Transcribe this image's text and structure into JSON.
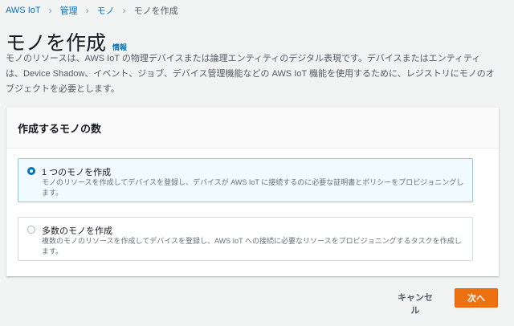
{
  "breadcrumb": [
    "AWS IoT",
    "管理",
    "モノ",
    "モノを作成"
  ],
  "header": {
    "title": "モノを作成",
    "info_link": "情報"
  },
  "description": "モノのリソースは、AWS IoT の物理デバイスまたは論理エンティティのデジタル表現です。デバイスまたはエンティティは、Device Shadow、イベント、ジョブ、デバイス管理機能などの AWS IoT 機能を使用するために、レジストリにモノのオブジェクトを必要とします。",
  "card": {
    "title": "作成するモノの数",
    "options": [
      {
        "label": "1 つのモノを作成",
        "description": "モノのリソースを作成してデバイスを登録し、デバイスが AWS IoT に接続するのに必要な証明書とポリシーをプロビジョニングします。",
        "selected": true
      },
      {
        "label": "多数のモノを作成",
        "description": "複数のモノのリソースを作成してデバイスを登録し、AWS IoT への接続に必要なリソースをプロビジョニングするタスクを作成します。",
        "selected": false
      }
    ]
  },
  "actions": {
    "cancel": "キャンセル",
    "next": "次へ"
  },
  "colors": {
    "accent": "#ec7211",
    "link": "#0073bb",
    "selected_bg": "#f1faff"
  }
}
